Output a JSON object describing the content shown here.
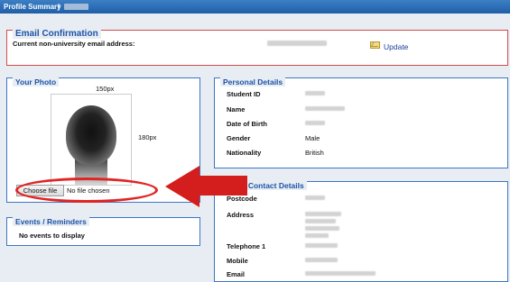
{
  "header": {
    "title": "Profile Summary",
    "separator": "|"
  },
  "email_confirmation": {
    "title": "Email Confirmation",
    "label": "Current non-university email address:",
    "update_label": "Update"
  },
  "photo": {
    "title": "Your Photo",
    "width_label": "150px",
    "height_label": "180px",
    "choose_file_label": "Choose file",
    "no_file_label": "No file chosen"
  },
  "events": {
    "title": "Events / Reminders",
    "empty_text": "No events to display"
  },
  "personal_details": {
    "title": "Personal Details",
    "rows": [
      {
        "label": "Student ID",
        "value": ""
      },
      {
        "label": "Name",
        "value": ""
      },
      {
        "label": "Date of Birth",
        "value": ""
      },
      {
        "label": "Gender",
        "value": "Male"
      },
      {
        "label": "Nationality",
        "value": "British"
      }
    ]
  },
  "home_contact": {
    "title": "ome Contact Details",
    "rows": [
      {
        "label": "Postcode"
      },
      {
        "label": "Address"
      },
      {
        "label": "Telephone 1"
      },
      {
        "label": "Mobile"
      },
      {
        "label": "Email"
      }
    ]
  },
  "colors": {
    "accent": "#1c54a8",
    "annotation_red": "#d41d1d"
  }
}
